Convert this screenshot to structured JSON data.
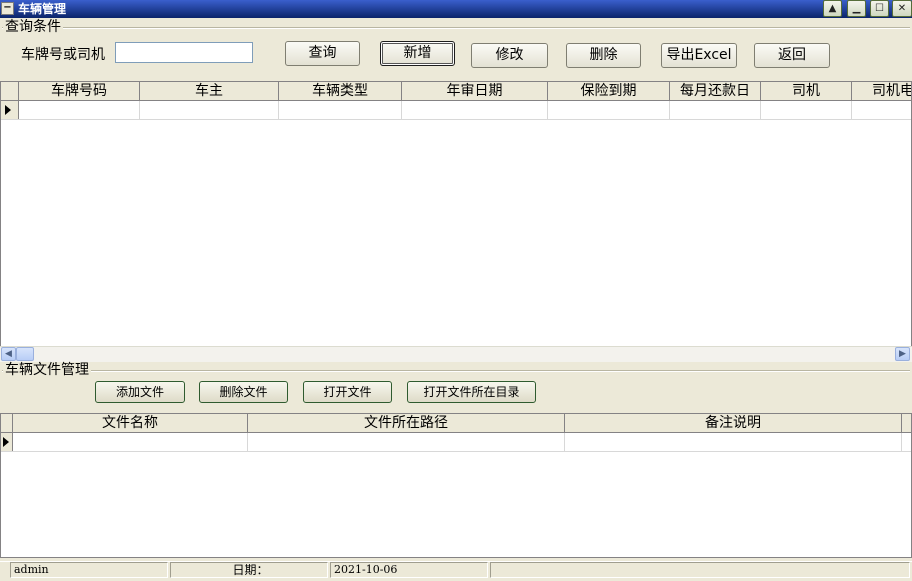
{
  "window": {
    "title": "车辆管理",
    "sys_icon": "minus-box-icon",
    "controls": [
      "triangle-up-icon",
      "minimize-icon",
      "maximize-icon",
      "close-icon"
    ]
  },
  "query": {
    "group_title": "查询条件",
    "label": "车牌号或司机",
    "input_value": "",
    "buttons": {
      "query": "查询",
      "add": "新增",
      "edit": "修改",
      "delete": "删除",
      "export": "导出Excel",
      "back": "返回"
    }
  },
  "vehicle_grid": {
    "columns": [
      "车牌号码",
      "车主",
      "车辆类型",
      "年审日期",
      "保险到期",
      "每月还款日",
      "司机",
      "司机电话"
    ],
    "rows": [
      [
        "",
        "",
        "",
        "",
        "",
        "",
        "",
        ""
      ]
    ]
  },
  "files": {
    "group_title": "车辆文件管理",
    "buttons": {
      "add": "添加文件",
      "delete": "删除文件",
      "open": "打开文件",
      "open_dir": "打开文件所在目录"
    },
    "columns": [
      "文件名称",
      "文件所在路径",
      "备注说明"
    ],
    "rows": [
      [
        "",
        "",
        ""
      ]
    ]
  },
  "status": {
    "user": "admin",
    "date_label": "日期：",
    "date_value": "2021-10-06"
  }
}
